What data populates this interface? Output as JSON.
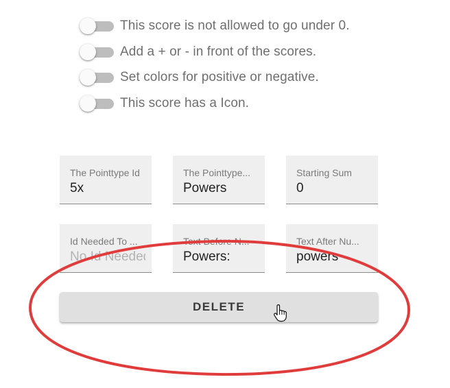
{
  "toggles": [
    {
      "label": "This score is not allowed to go under 0.",
      "checked": false
    },
    {
      "label": "Add a + or - in front of the scores.",
      "checked": false
    },
    {
      "label": "Set colors for positive or negative.",
      "checked": false
    },
    {
      "label": "This score has a Icon.",
      "checked": false
    }
  ],
  "fields": {
    "pointtype_id": {
      "label": "The Pointtype Id",
      "value": "5x",
      "placeholder": ""
    },
    "pointtype_name": {
      "label": "The Pointtype...",
      "value": "Powers",
      "placeholder": ""
    },
    "starting_sum": {
      "label": "Starting Sum",
      "value": "0",
      "placeholder": ""
    },
    "id_needed": {
      "label": "Id Needed To ...",
      "value": "",
      "placeholder": "No Id Needed"
    },
    "text_before": {
      "label": "Text Before N...",
      "value": "Powers:",
      "placeholder": ""
    },
    "text_after": {
      "label": "Text After Nu...",
      "value": "powers",
      "placeholder": ""
    }
  },
  "delete_button": {
    "label": "DELETE"
  },
  "annotation": {
    "color": "#e03c3c"
  },
  "colors": {
    "field_background": "#efefef",
    "button_background": "#e0e0e0",
    "toggle_track": "#bdbdbd"
  },
  "icons": {
    "cursor": "hand-pointer-icon"
  }
}
